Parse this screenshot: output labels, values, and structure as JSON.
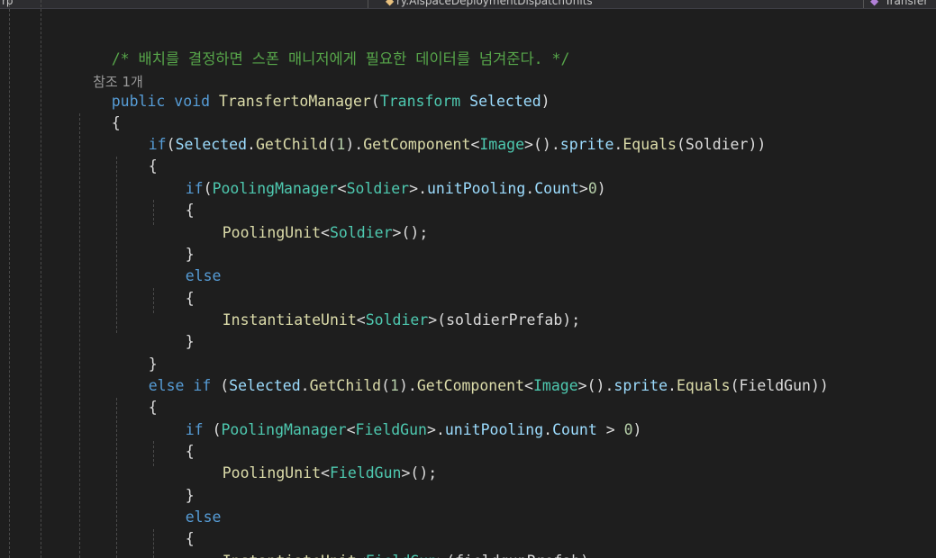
{
  "tabs": {
    "left_fragment": "rp",
    "middle_fragment": "ry.AispaceDeploymentDispatchUnits",
    "right_fragment": "Transfer"
  },
  "codelens": "참조 1개",
  "code": {
    "comment": "/* 배치를 결정하면 스폰 매니저에게 필요한 데이터를 넘겨준다. */",
    "kw_public": "public",
    "kw_void": "void",
    "method_name": "TransfertoManager",
    "param_type": "Transform",
    "param_name": "Selected",
    "open_brace": "{",
    "close_brace": "}",
    "open_paren": "(",
    "close_paren": ")",
    "kw_if": "if",
    "kw_else": "else",
    "kw_else_if": "else if",
    "var_selected": "Selected",
    "dot": ".",
    "m_getchild": "GetChild",
    "num_one": "1",
    "m_getcomponent": "GetComponent",
    "lt": "<",
    "gt": ">",
    "type_image": "Image",
    "m_sprite": "sprite",
    "m_equals": "Equals",
    "type_pooling_manager": "PoolingManager",
    "type_soldier": "Soldier",
    "type_fieldgun": "FieldGun",
    "m_unitpooling": "unitPooling",
    "m_count": "Count",
    "num_zero": "0",
    "m_poolingunit": "PoolingUnit",
    "m_instantiateunit": "InstantiateUnit",
    "arg_soldier_prefab": "soldierPrefab",
    "arg_fieldgun_prefab": "fieldgunPrefab",
    "end_call": "();",
    "end_stmt": ");",
    "close_paren_2": "))",
    "close_paren_3": "()",
    "gt_zero_close": ">0)",
    "space_gt_space": " > ",
    "space": " "
  },
  "colors": {
    "background": "#1e1e1e",
    "keyword": "#569cd6",
    "type": "#4ec9b0",
    "method": "#dcdcaa",
    "variable": "#9cdcfe",
    "number": "#b5cea8",
    "comment": "#57a64a",
    "plain": "#dcdcdc",
    "codelens": "#999999"
  }
}
